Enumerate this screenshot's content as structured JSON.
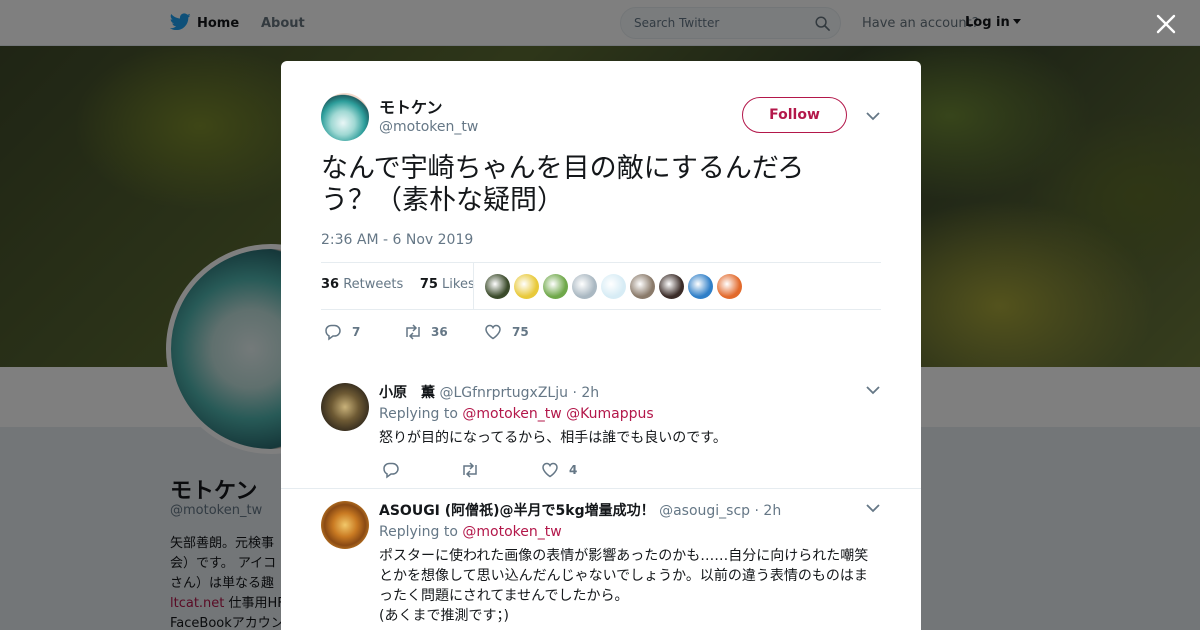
{
  "nav": {
    "home": "Home",
    "about": "About",
    "search_placeholder": "Search Twitter",
    "have_account": "Have an account?",
    "login": "Log in"
  },
  "profile": {
    "name": "モトケン",
    "handle": "@motoken_tw",
    "bio_lines": [
      "矢部善朗。元検事",
      "会）です。 アイコ",
      "さん）は単なる趣"
    ],
    "link": "ltcat.net",
    "link_suffix": " 仕事用HF",
    "bio_last": "FaceBookアカウン"
  },
  "tweet": {
    "author_name": "モトケン",
    "author_handle": "@motoken_tw",
    "follow_label": "Follow",
    "text": "なんで宇崎ちゃんを目の敵にするんだろう？（素朴な疑問）",
    "timestamp": "2:36 AM - 6 Nov 2019",
    "retweets_count": "36",
    "retweets_label": "Retweets",
    "likes_count": "75",
    "likes_label": "Likes",
    "actions": {
      "reply_count": "7",
      "retweet_count": "36",
      "like_count": "75"
    }
  },
  "replies": [
    {
      "name": "小原　薫",
      "handle": "@LGfnrprtugxZLju",
      "time": "· 2h",
      "replying_label": "Replying to",
      "mentions": [
        "@motoken_tw",
        "@Kumappus"
      ],
      "text": "怒りが目的になってるから、相手は誰でも良いのです。",
      "like_count": "4"
    },
    {
      "name": "ASOUGI (阿僧祇)@半月で5kg増量成功！",
      "handle": "@asougi_scp",
      "time": "· 2h",
      "replying_label": "Replying to",
      "mentions": [
        "@motoken_tw"
      ],
      "text_lines": [
        "ポスターに使われた画像の表情が影響あったのかも……自分に向けられた嘲笑",
        "とかを想像して思い込んだんじゃないでしょうか。以前の違う表情のものはま",
        "ったく問題にされてませんでしたから。",
        "(あくまで推測です；)"
      ]
    }
  ],
  "colors": {
    "accent": "#b3174a",
    "twitter_blue": "#1da1f2",
    "secondary_text": "#657786"
  },
  "likers": [
    {
      "icon": "liker-avatar-1",
      "color": "#3a4a2a"
    },
    {
      "icon": "liker-avatar-2",
      "color": "#e8c93a"
    },
    {
      "icon": "liker-avatar-3",
      "color": "#6fa84a"
    },
    {
      "icon": "liker-avatar-4",
      "color": "#aab8c2"
    },
    {
      "icon": "liker-avatar-5",
      "color": "#d7ecf5"
    },
    {
      "icon": "liker-avatar-6",
      "color": "#8a7a6a"
    },
    {
      "icon": "liker-avatar-7",
      "color": "#3b2c28"
    },
    {
      "icon": "liker-avatar-8",
      "color": "#2f7fc8"
    },
    {
      "icon": "liker-avatar-9",
      "color": "#e26a2c"
    }
  ]
}
